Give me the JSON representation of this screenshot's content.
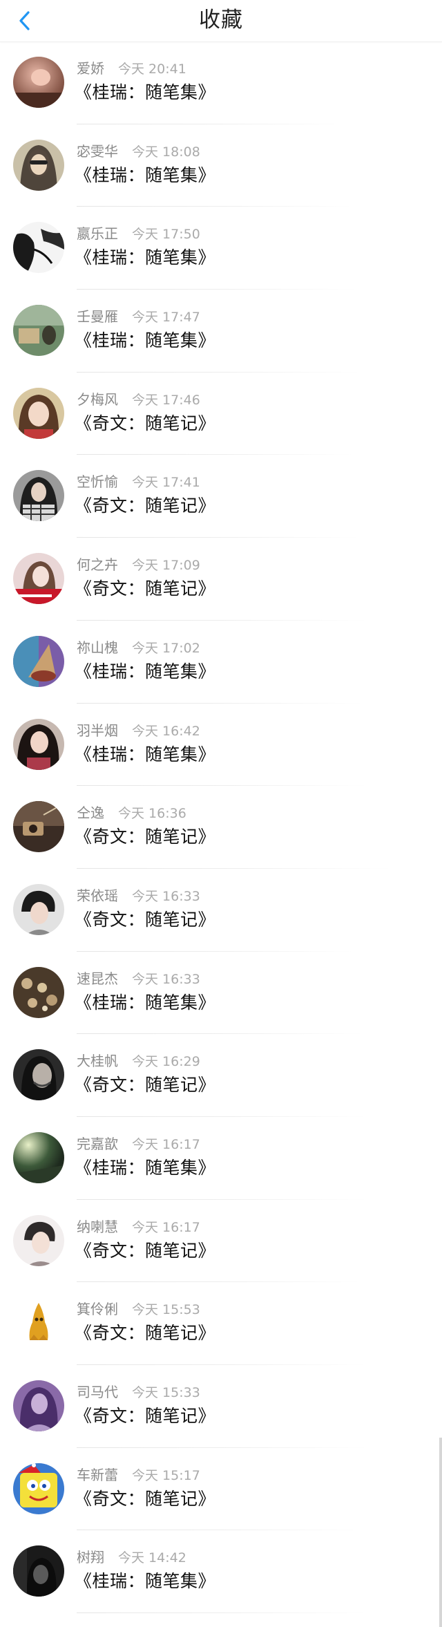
{
  "header": {
    "title": "收藏",
    "back_icon": "chevron-left-icon",
    "accent_color": "#2196F3"
  },
  "items": [
    {
      "name": "爱娇",
      "time": "今天 20:41",
      "title": "《桂瑞：随笔集》",
      "avatar_icon": "user-avatar-icon"
    },
    {
      "name": "宓雯华",
      "time": "今天 18:08",
      "title": "《桂瑞：随笔集》",
      "avatar_icon": "user-avatar-icon"
    },
    {
      "name": "嬴乐正",
      "time": "今天 17:50",
      "title": "《桂瑞：随笔集》",
      "avatar_icon": "user-avatar-icon"
    },
    {
      "name": "壬曼雁",
      "time": "今天 17:47",
      "title": "《桂瑞：随笔集》",
      "avatar_icon": "user-avatar-icon"
    },
    {
      "name": "夕梅风",
      "time": "今天 17:46",
      "title": "《奇文：随笔记》",
      "avatar_icon": "user-avatar-icon"
    },
    {
      "name": "空忻愉",
      "time": "今天 17:41",
      "title": "《奇文：随笔记》",
      "avatar_icon": "user-avatar-icon"
    },
    {
      "name": "何之卉",
      "time": "今天 17:09",
      "title": "《奇文：随笔记》",
      "avatar_icon": "user-avatar-icon"
    },
    {
      "name": "祢山槐",
      "time": "今天 17:02",
      "title": "《桂瑞：随笔集》",
      "avatar_icon": "user-avatar-icon"
    },
    {
      "name": "羽半烟",
      "time": "今天 16:42",
      "title": "《桂瑞：随笔集》",
      "avatar_icon": "user-avatar-icon"
    },
    {
      "name": "仝逸",
      "time": "今天 16:36",
      "title": "《奇文：随笔记》",
      "avatar_icon": "user-avatar-icon"
    },
    {
      "name": "荣依瑶",
      "time": "今天 16:33",
      "title": "《奇文：随笔记》",
      "avatar_icon": "user-avatar-icon"
    },
    {
      "name": "速昆杰",
      "time": "今天 16:33",
      "title": "《桂瑞：随笔集》",
      "avatar_icon": "user-avatar-icon"
    },
    {
      "name": "大桂帆",
      "time": "今天 16:29",
      "title": "《奇文：随笔记》",
      "avatar_icon": "user-avatar-icon"
    },
    {
      "name": "完嘉歆",
      "time": "今天 16:17",
      "title": "《桂瑞：随笔集》",
      "avatar_icon": "user-avatar-icon"
    },
    {
      "name": "纳喇慧",
      "time": "今天 16:17",
      "title": "《奇文：随笔记》",
      "avatar_icon": "user-avatar-icon"
    },
    {
      "name": "箕伶俐",
      "time": "今天 15:53",
      "title": "《奇文：随笔记》",
      "avatar_icon": "user-avatar-icon"
    },
    {
      "name": "司马代",
      "time": "今天 15:33",
      "title": "《奇文：随笔记》",
      "avatar_icon": "user-avatar-icon"
    },
    {
      "name": "车新蕾",
      "time": "今天 15:17",
      "title": "《奇文：随笔记》",
      "avatar_icon": "user-avatar-icon"
    },
    {
      "name": "树翔",
      "time": "今天 14:42",
      "title": "《桂瑞：随笔集》",
      "avatar_icon": "user-avatar-icon"
    }
  ]
}
